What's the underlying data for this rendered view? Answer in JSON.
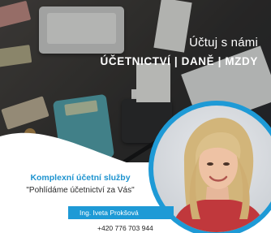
{
  "headline": {
    "line1": "Účtuj s námi",
    "line2": "ÚČETNICTVÍ | DANĚ | MZDY"
  },
  "services": {
    "title": "Komplexní účetní služby",
    "tagline": "\"Pohlídáme účetnictví za Vás\""
  },
  "contact": {
    "name": "Ing. Iveta Prokšová",
    "phone": "+420 776 703 944"
  },
  "colors": {
    "accent": "#1e9ad6",
    "title": "#1d93cf",
    "portrait_top": "#8a5a55"
  }
}
